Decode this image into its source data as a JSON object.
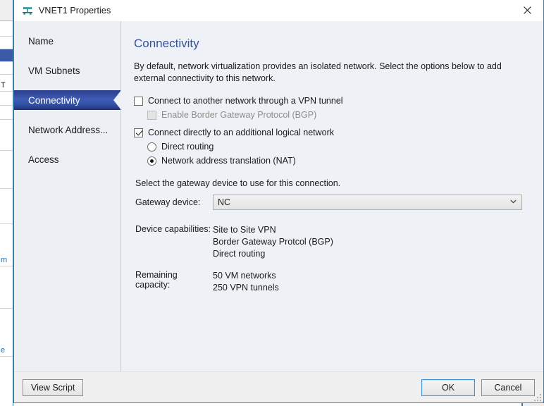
{
  "background_window": {
    "rows": [
      "",
      "",
      "",
      "",
      "",
      "T",
      "",
      "",
      "",
      "",
      "",
      "m",
      "",
      "e"
    ]
  },
  "titlebar": {
    "icon": "network-subnet-icon",
    "title": "VNET1 Properties",
    "close_label": "✕"
  },
  "sidebar": {
    "items": [
      {
        "label": "Name",
        "selected": false
      },
      {
        "label": "VM Subnets",
        "selected": false
      },
      {
        "label": "Connectivity",
        "selected": true
      },
      {
        "label": "Network Address...",
        "selected": false
      },
      {
        "label": "Access",
        "selected": false
      }
    ]
  },
  "content": {
    "heading": "Connectivity",
    "description": "By default, network virtualization provides an isolated network. Select the options below to add external connectivity to this network.",
    "options": [
      {
        "type": "checkbox",
        "label": "Connect to another network through a VPN tunnel",
        "checked": false,
        "disabled": false,
        "indent": false
      },
      {
        "type": "checkbox",
        "label": "Enable Border Gateway Protocol (BGP)",
        "checked": false,
        "disabled": true,
        "indent": true
      },
      {
        "type": "checkbox",
        "label": "Connect directly to an additional logical network",
        "checked": true,
        "disabled": false,
        "indent": false
      },
      {
        "type": "radio",
        "label": "Direct routing",
        "checked": false,
        "disabled": false,
        "indent": true
      },
      {
        "type": "radio",
        "label": "Network address translation (NAT)",
        "checked": true,
        "disabled": false,
        "indent": true
      }
    ],
    "gateway_instruction": "Select the gateway device to use for this connection.",
    "gateway_label": "Gateway device:",
    "gateway_value": "NC",
    "gateway_arrow": "⌄",
    "device_capabilities_label": "Device capabilities:",
    "device_capabilities": [
      "Site to Site VPN",
      "Border Gateway Protcol (BGP)",
      "Direct routing"
    ],
    "remaining_capacity_label": "Remaining capacity:",
    "remaining_capacity": [
      "50 VM networks",
      "250 VPN tunnels"
    ]
  },
  "footer": {
    "view_script_label": "View Script",
    "ok_label": "OK",
    "cancel_label": "Cancel"
  },
  "colors": {
    "heading_blue": "#33519e",
    "selected_nav_blue": "#2b3f8c",
    "dialog_border": "#3b7ca8",
    "content_bg": "#eef2f6",
    "focus_blue": "#3b8fd4"
  }
}
